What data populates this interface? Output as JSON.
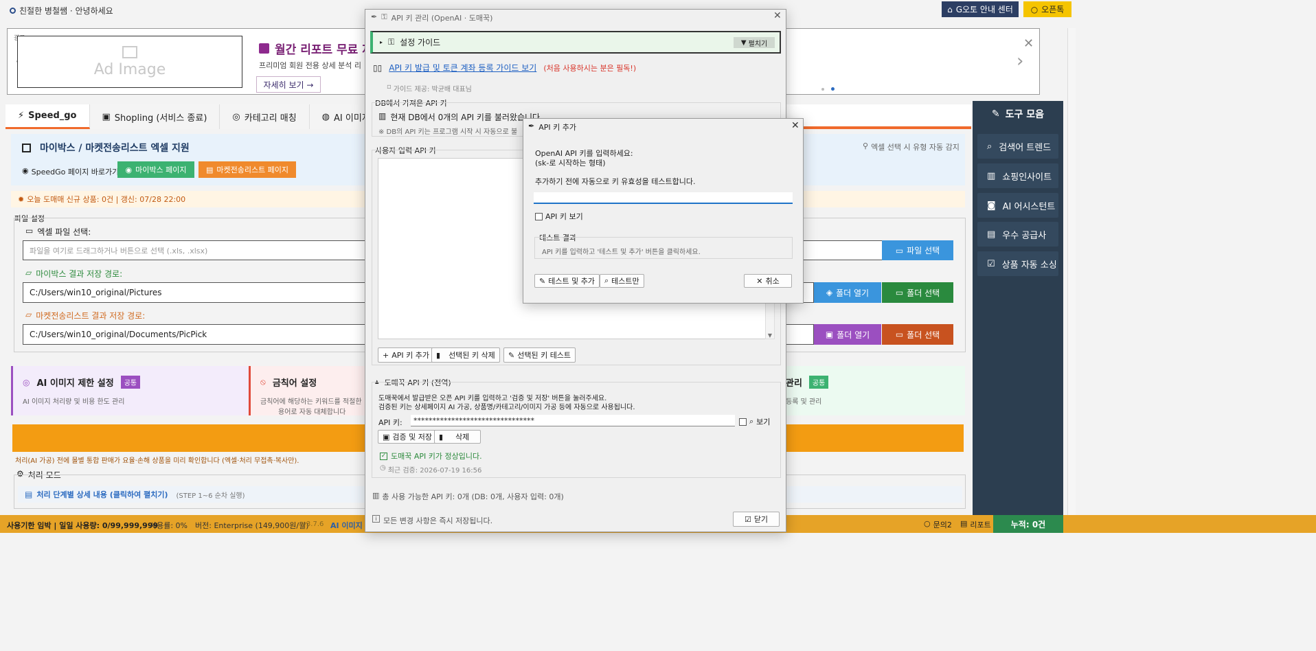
{
  "topbar": {
    "greeting": "친절한 병철쌤 · 안녕하세요",
    "guide_button": "G오토 안내 센터",
    "chat_button": "오픈톡"
  },
  "banner": {
    "ad_label": "광고",
    "ad_placeholder": "Ad Image",
    "title": "월간 리포트 무료 제",
    "subtitle": "프리미엄 회원 전용 상세 분석 리",
    "detail_button": "자세히 보기 →"
  },
  "tabs": [
    "Speed_go",
    "Shopling (서비스 종료)",
    "카테고리 매칭",
    "AI 이미지 변조"
  ],
  "section": {
    "title": "마이박스 / 마켓전송리스트 엑셀 지원",
    "auto_detect": "엑셀 선택 시 유형 자동 감지",
    "shortcut_label": "SpeedGo 페이지 바로가기:",
    "mybox_page": "마이박스 페이지",
    "market_page": "마켓전송리스트 페이지"
  },
  "notice": "오늘 도매매 신규 상품: 0건 | 갱신: 07/28 22:00",
  "file_settings": {
    "group_title": "파일 설정",
    "excel_label": "엑셀 파일 선택:",
    "excel_placeholder": "파일을 여기로 드래그하거나 버튼으로 선택  (.xls, .xlsx)",
    "file_select": "파일 선택",
    "mybox_path_label": "마이박스 결과 저장 경로:",
    "mybox_path": "C:/Users/win10_original/Pictures",
    "market_path_label": "마켓전송리스트 결과 저장 경로:",
    "market_path": "C:/Users/win10_original/Documents/PicPick",
    "open_folder": "폴더 열기",
    "select_folder": "폴더 선택"
  },
  "cards": [
    {
      "title": "AI 이미지 제한 설정",
      "badge": "공통",
      "desc": "AI 이미지 처리량 및 비용 한도 관리"
    },
    {
      "title": "금칙어 설정",
      "desc": "금칙어에 해당하는 키워드를 적절한",
      "desc2": "용어로 자동 대체합니다"
    },
    {
      "title": "관리",
      "badge": "공통",
      "desc": "등록 및 관리"
    }
  ],
  "warning_text": "처리(AI 가공) 전에 몰별 통합 판매가 요율·손해 상품을 미리 확인합니다 (엑셀·처리 무접촉·복사만).",
  "process": {
    "title": "처리 모드",
    "steps_link": "처리 단계별 상세 내용 (클릭하여 펼치기)",
    "steps_hint": "(STEP 1~6 순차 실행)"
  },
  "sidebar": {
    "title": "도구 모음",
    "items": [
      "검색어 트렌드",
      "쇼핑인사이트",
      "AI 어시스턴트",
      "우수 공급사",
      "상품 자동 소싱"
    ]
  },
  "statusbar": {
    "usage": "사용기한 임박 | 일일 사용량: 0/99,999,999",
    "rate": "사용률: 0%",
    "version": "버전: Enterprise (149,900원/월)",
    "ver": "v3.7.6",
    "ai": "AI 이미지",
    "inquiry": "문의2",
    "report": "리포트",
    "total": "누적: 0건"
  },
  "main_dialog": {
    "title": "API 키 관리 (OpenAI · 도매꾹)",
    "guide_title": "설정 가이드",
    "expand": "펼치기",
    "guide_link": "API 키 발급 및 토큰 계좌 등록 가이드 보기",
    "guide_note": "(처음 사용하시는 분은 필독!)",
    "guide_credit": "가이드 제공: 박균배 대표님",
    "db_group": "DB에서 가져온 API 키",
    "db_status": "현재 DB에서 0개의 API 키를 불러왔습니다",
    "db_note": "※ DB의 API 키는 프로그램 시작 시 자동으로 불",
    "user_group": "사용자 입력 API 키",
    "add_key": "API 키 추가",
    "delete_key": "선택된 키 삭제",
    "test_key": "선택된 키 테스트",
    "domeggook_group": "도매꾹 API 키 (전역)",
    "domeggook_desc1": "도매꾹에서 발급받은 오픈 API 키를 입력하고 '검증 및 저장' 버튼을 눌러주세요.",
    "domeggook_desc2": "검증된 키는 상세페이지 AI 가공, 상품명/카테고리/이미지 가공 등에 자동으로 사용됩니다.",
    "api_key_label": "API 키:",
    "api_key_value": "********************************",
    "show": "보기",
    "verify_save": "검증 및 저장",
    "delete": "삭제",
    "valid": "도매꾹 API 키가 정상입니다.",
    "last_verified": "최근 검증: 2026-07-19 16:56",
    "total_keys": "총 사용 가능한 API 키: 0개 (DB: 0개, 사용자 입력: 0개)",
    "autosave": "모든 변경 사항은 즉시 저장됩니다.",
    "close": "닫기"
  },
  "add_dialog": {
    "title": "API 키 추가",
    "prompt1": "OpenAI API 키를 입력하세요:",
    "prompt2": "(sk-로 시작하는 형태)",
    "prompt3": "추가하기 전에 자동으로 키 유효성을 테스트합니다.",
    "input_value": "",
    "show_key": "API 키 보기",
    "result_group": "테스트 결과",
    "result_text": "API 키를 입력하고 '테스트 및 추가' 버튼을 클릭하세요.",
    "test_add": "테스트 및 추가",
    "test_only": "테스트만",
    "cancel": "취소"
  }
}
